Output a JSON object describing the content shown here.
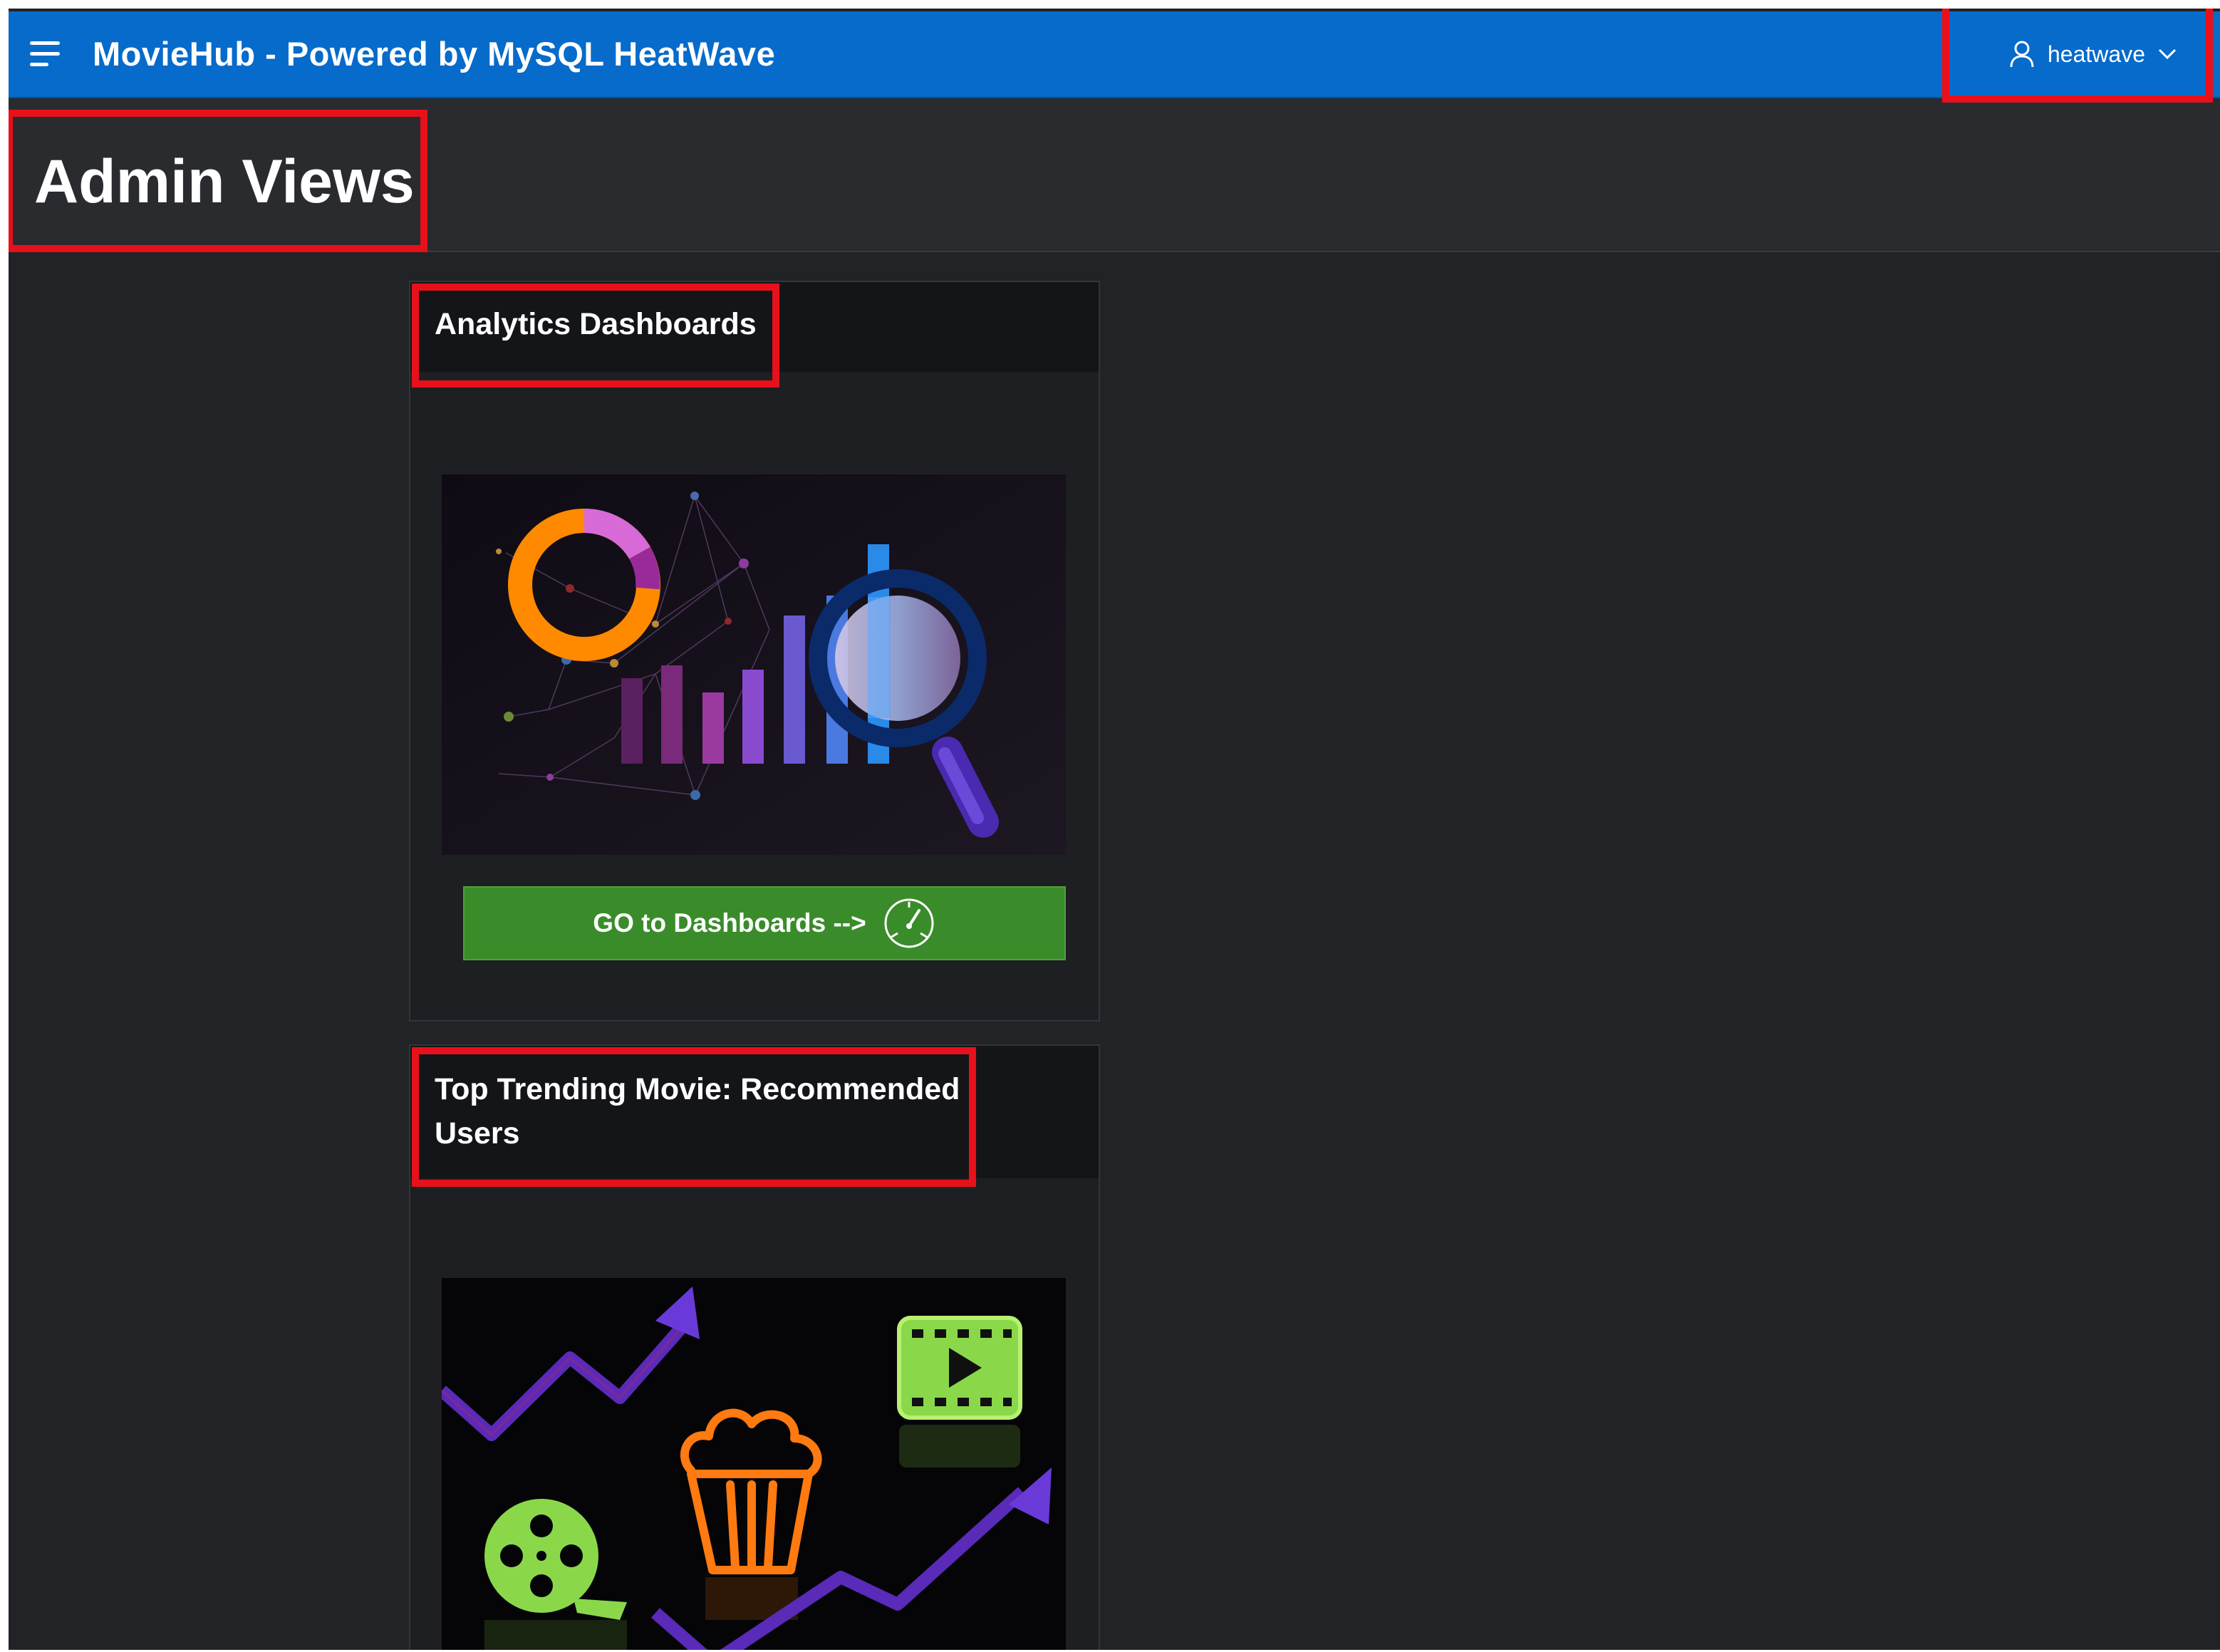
{
  "header": {
    "app_title": "MovieHub - Powered by MySQL HeatWave",
    "username": "heatwave",
    "brand_color": "#066bcb",
    "icons": [
      "menu-icon",
      "user-icon",
      "chevron-down-icon"
    ]
  },
  "page": {
    "title": "Admin Views"
  },
  "cards": [
    {
      "title": "Analytics Dashboards",
      "image_icon": "analytics-dashboard-illustration",
      "button_label": "GO to Dashboards -->",
      "button_icon": "speedometer-icon",
      "button_color": "#3a8c2a"
    },
    {
      "title": "Top Trending Movie: Recommended Users",
      "image_icon": "trending-movies-illustration"
    }
  ],
  "annotation_color": "#e8101a"
}
